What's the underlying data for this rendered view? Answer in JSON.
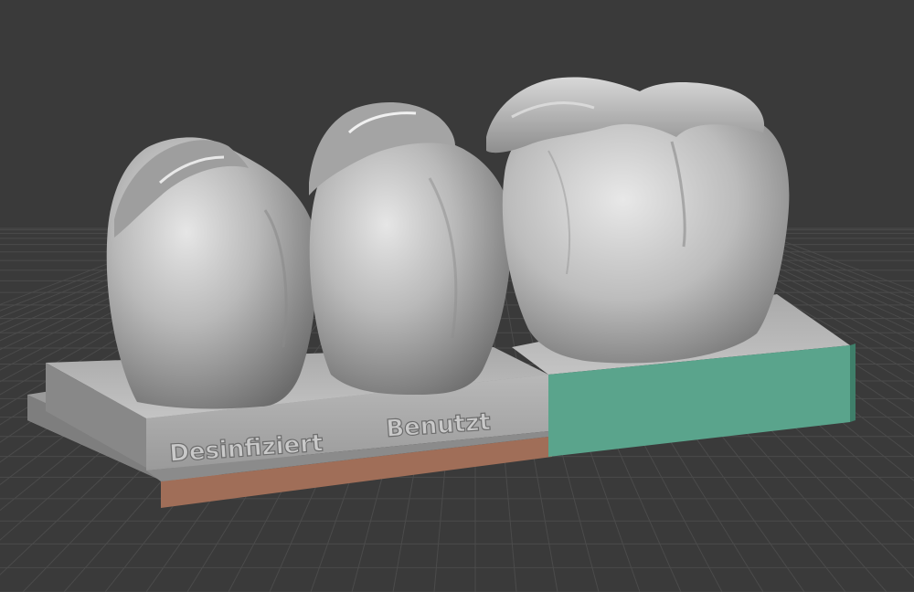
{
  "scene": {
    "background_color": "#3a3a3a",
    "grid_color": "#4a4a4a",
    "model_color": "#b4b4b4",
    "accent_colors": {
      "front_strip_copper": "#a06e58",
      "right_block_teal": "#5aa48c"
    }
  },
  "labels": {
    "left": "Desinfiziert",
    "right": "Benutzt"
  },
  "objects": [
    {
      "name": "left-tooth"
    },
    {
      "name": "middle-tooth"
    },
    {
      "name": "molar"
    },
    {
      "name": "base-platform"
    }
  ]
}
